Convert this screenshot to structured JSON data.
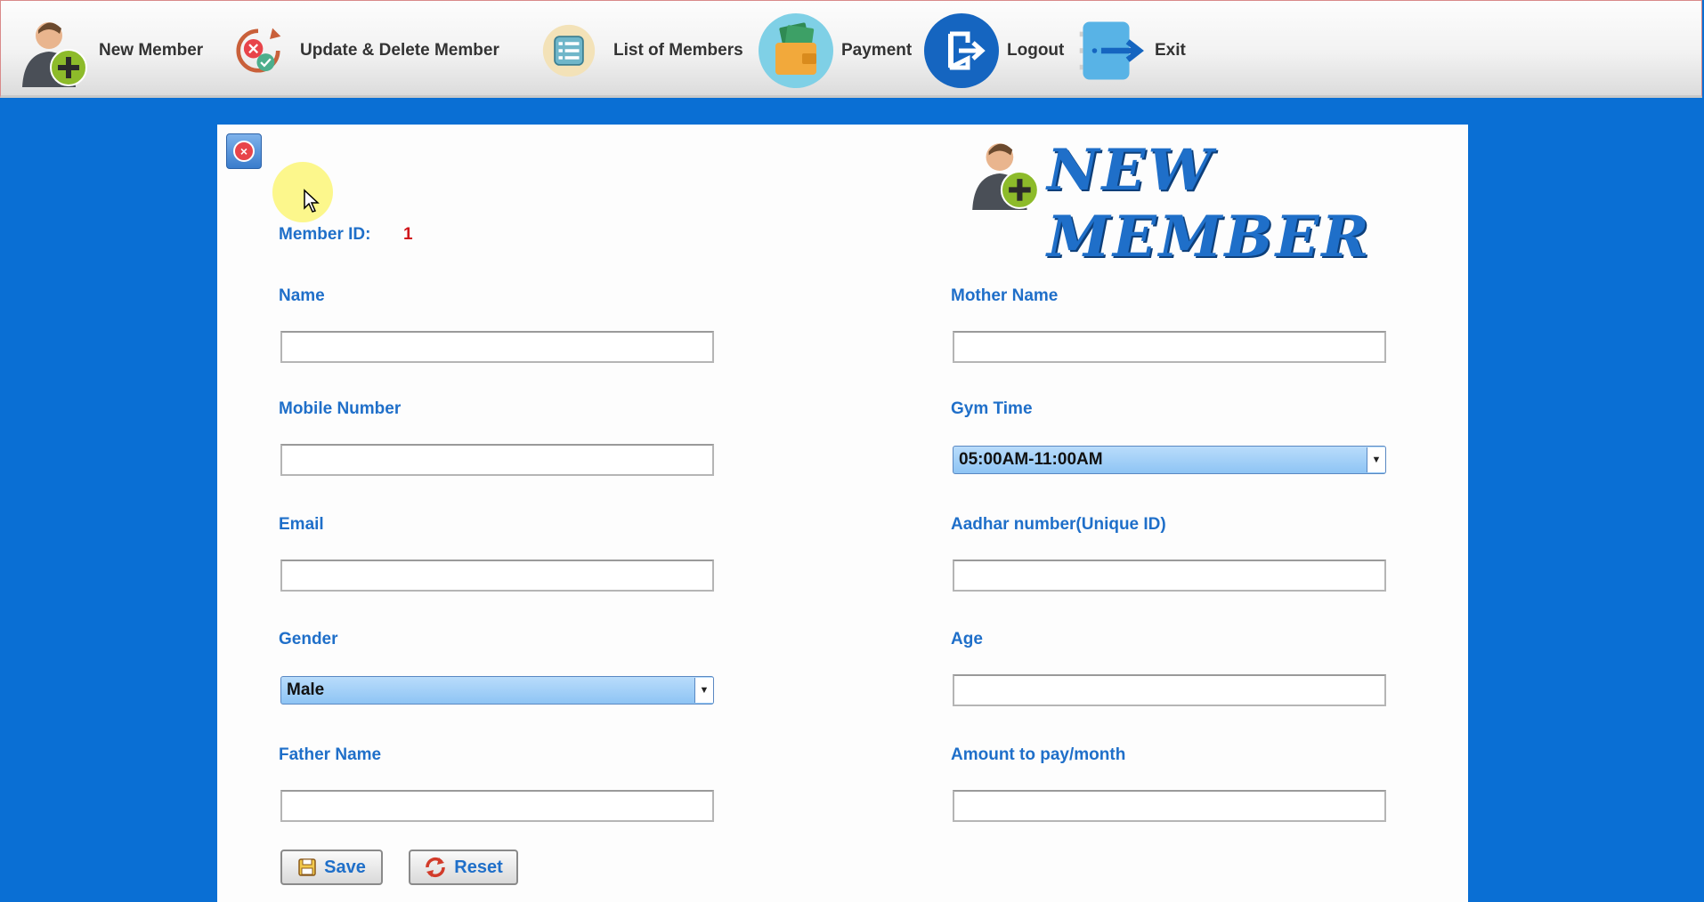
{
  "toolbar": {
    "items": [
      {
        "label": "New Member",
        "icon": "add-user-icon"
      },
      {
        "label": "Update & Delete Member",
        "icon": "update-delete-icon"
      },
      {
        "label": "List of Members",
        "icon": "list-icon"
      },
      {
        "label": "Payment",
        "icon": "wallet-icon"
      },
      {
        "label": "Logout",
        "icon": "logout-icon"
      },
      {
        "label": "Exit",
        "icon": "exit-icon"
      }
    ]
  },
  "panel": {
    "title": "NEW MEMBER",
    "member_id_label": "Member ID:",
    "member_id_value": "1",
    "fields": {
      "name": {
        "label": "Name",
        "value": ""
      },
      "mobile": {
        "label": "Mobile Number",
        "value": ""
      },
      "email": {
        "label": "Email",
        "value": ""
      },
      "gender": {
        "label": "Gender",
        "value": "Male"
      },
      "father": {
        "label": "Father Name",
        "value": ""
      },
      "mother": {
        "label": "Mother Name",
        "value": ""
      },
      "gym_time": {
        "label": "Gym Time",
        "value": "05:00AM-11:00AM"
      },
      "aadhar": {
        "label": "Aadhar number(Unique ID)",
        "value": ""
      },
      "age": {
        "label": "Age",
        "value": ""
      },
      "amount": {
        "label": "Amount to pay/month",
        "value": ""
      }
    },
    "buttons": {
      "save": "Save",
      "reset": "Reset"
    }
  },
  "colors": {
    "background": "#0a6fd4",
    "label": "#1f6fc9",
    "member_id": "#d0161b",
    "select_fill": "#8ec4f4"
  }
}
